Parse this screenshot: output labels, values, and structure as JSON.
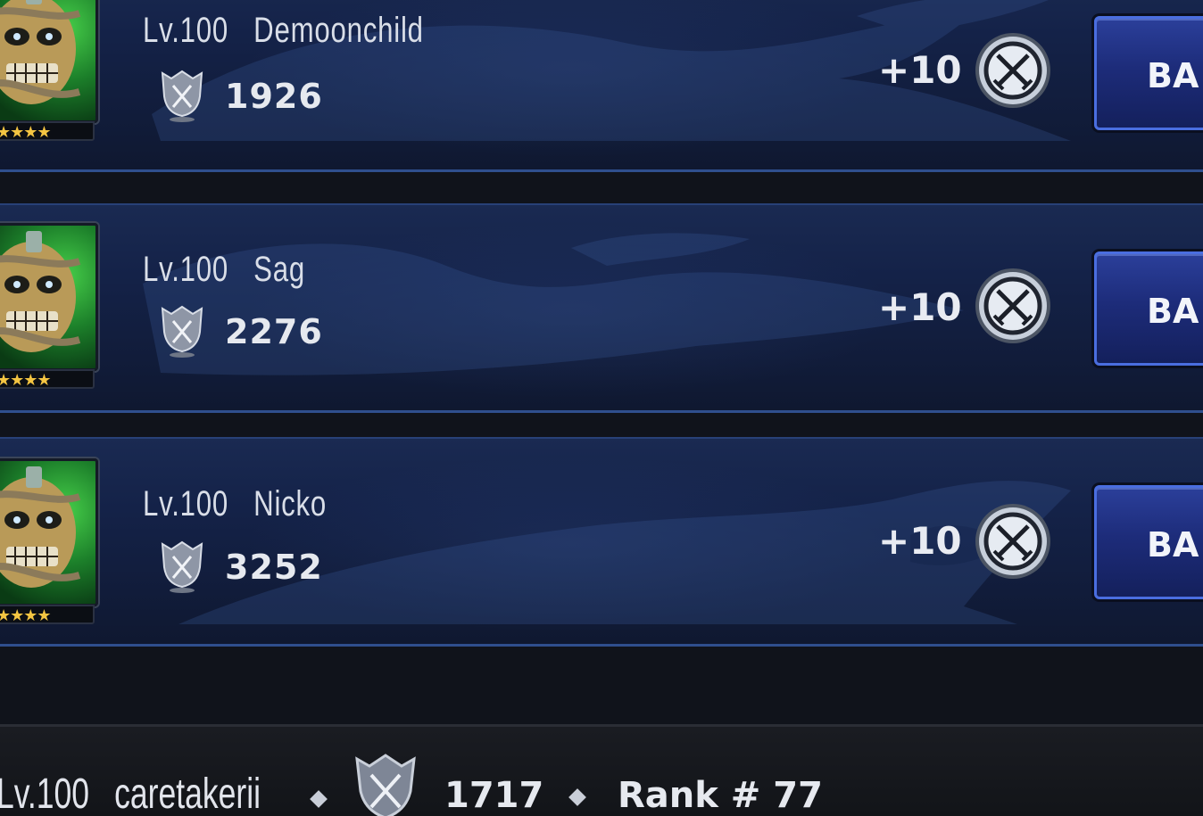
{
  "colors": {
    "row_background": "#142248",
    "row_border": "#2f4f8e",
    "battle_button": "#1d2c7a",
    "star": "#f4c542",
    "text": "#e6e9ef"
  },
  "opponents": [
    {
      "level": "Lv.100",
      "name": "Demoonchild",
      "trophy_icon": "trophy-icon",
      "score": "1926",
      "reward": "+10",
      "reward_icon": "crossed-swords-coin-icon",
      "stars": "★★★★",
      "battle_label": "BA"
    },
    {
      "level": "Lv.100",
      "name": "Sag",
      "trophy_icon": "trophy-icon",
      "score": "2276",
      "reward": "+10",
      "reward_icon": "crossed-swords-coin-icon",
      "stars": "★★★★",
      "battle_label": "BA"
    },
    {
      "level": "Lv.100",
      "name": "Nicko",
      "trophy_icon": "trophy-icon",
      "score": "3252",
      "reward": "+10",
      "reward_icon": "crossed-swords-coin-icon",
      "stars": "★★★★",
      "battle_label": "BA"
    }
  ],
  "player": {
    "level": "Lv.100",
    "name": "caretakerii",
    "score": "1717",
    "rank": "Rank # 77"
  }
}
